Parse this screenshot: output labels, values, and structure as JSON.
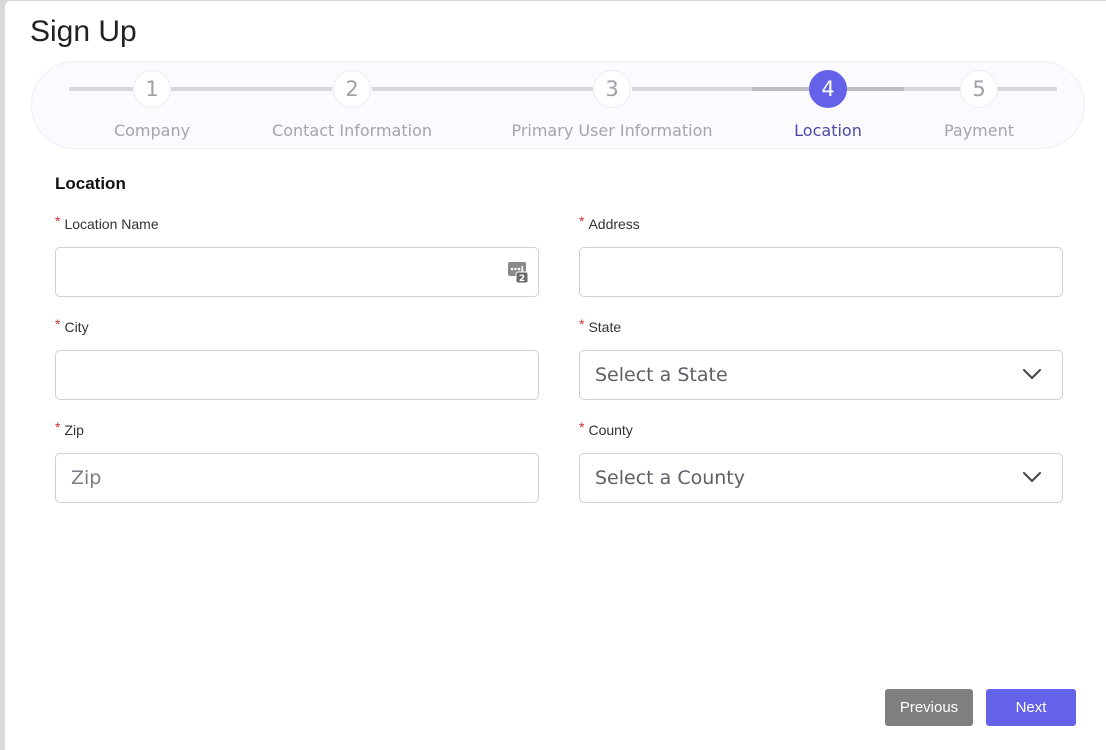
{
  "header": {
    "title": "Sign Up"
  },
  "stepper": {
    "steps": [
      {
        "number": "1",
        "label": "Company"
      },
      {
        "number": "2",
        "label": "Contact Information"
      },
      {
        "number": "3",
        "label": "Primary User Information"
      },
      {
        "number": "4",
        "label": "Location"
      },
      {
        "number": "5",
        "label": "Payment"
      }
    ],
    "current_step": "4",
    "active_color": "#6562ea"
  },
  "form": {
    "section_title": "Location",
    "required_marker": "*",
    "location_name": {
      "label": "Location Name",
      "value": "",
      "placeholder": ""
    },
    "address": {
      "label": "Address",
      "value": "",
      "placeholder": ""
    },
    "city": {
      "label": "City",
      "value": "",
      "placeholder": ""
    },
    "state": {
      "label": "State",
      "selected": "Select a State"
    },
    "zip": {
      "label": "Zip",
      "value": "",
      "placeholder": "Zip"
    },
    "county": {
      "label": "County",
      "selected": "Select a County"
    }
  },
  "actions": {
    "previous_label": "Previous",
    "next_label": "Next"
  },
  "icons": {
    "autofill": "password-manager-icon",
    "dropdown": "chevron-down-icon"
  }
}
